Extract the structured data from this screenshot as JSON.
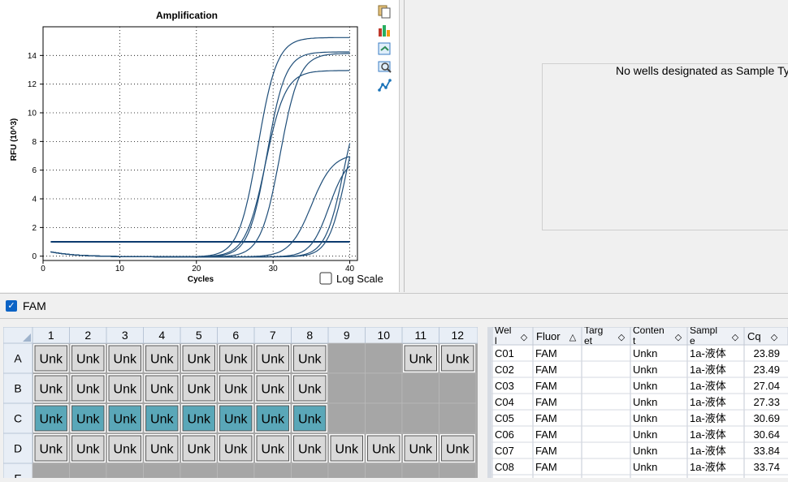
{
  "chart": {
    "title": "Amplification",
    "xlabel": "Cycles",
    "ylabel": "RFU (10^3)",
    "log_scale_label": "Log Scale",
    "x_ticks": [
      "0",
      "10",
      "20",
      "30",
      "40"
    ],
    "y_ticks": [
      "0",
      "2",
      "4",
      "6",
      "8",
      "10",
      "12",
      "14"
    ]
  },
  "chart_data": {
    "type": "line",
    "title": "Amplification",
    "xlabel": "Cycles",
    "ylabel": "RFU (10^3)",
    "xlim": [
      0,
      41
    ],
    "ylim": [
      -0.3,
      16
    ],
    "grid": true,
    "threshold": 1.0,
    "series": [
      {
        "values_at": "sigmoid",
        "baseline": 0.0,
        "max": 15.3,
        "midpoint": 28.0,
        "slope": 1.25
      },
      {
        "values_at": "sigmoid",
        "baseline": 0.0,
        "max": 14.3,
        "midpoint": 29.2,
        "slope": 1.2
      },
      {
        "values_at": "sigmoid",
        "baseline": 0.0,
        "max": 13.0,
        "midpoint": 29.0,
        "slope": 1.3
      },
      {
        "values_at": "sigmoid",
        "baseline": 0.0,
        "max": 14.2,
        "midpoint": 30.9,
        "slope": 1.25
      },
      {
        "values_at": "sigmoid",
        "baseline": 0.0,
        "max": 7.2,
        "midpoint": 35.0,
        "slope": 1.4
      },
      {
        "values_at": "sigmoid",
        "baseline": 0.0,
        "max": 7.0,
        "midpoint": 37.3,
        "slope": 1.2
      },
      {
        "values_at": "sigmoid",
        "baseline": 0.0,
        "max": 12.0,
        "midpoint": 39.2,
        "slope": 1.2
      },
      {
        "values_at": "sigmoid",
        "baseline": 0.0,
        "max": 11.5,
        "midpoint": 39.5,
        "slope": 1.15
      }
    ]
  },
  "right_pane": {
    "message": "No wells designated as Sample Ty"
  },
  "fluor_bar": {
    "label": "FAM",
    "checked": true
  },
  "plate": {
    "columns": [
      "1",
      "2",
      "3",
      "4",
      "5",
      "6",
      "7",
      "8",
      "9",
      "10",
      "11",
      "12"
    ],
    "rows": [
      {
        "label": "A",
        "wells": [
          "Unk",
          "Unk",
          "Unk",
          "Unk",
          "Unk",
          "Unk",
          "Unk",
          "Unk",
          "",
          "",
          "Unk",
          "Unk"
        ],
        "selected": false
      },
      {
        "label": "B",
        "wells": [
          "Unk",
          "Unk",
          "Unk",
          "Unk",
          "Unk",
          "Unk",
          "Unk",
          "Unk",
          "",
          "",
          "",
          ""
        ],
        "selected": false
      },
      {
        "label": "C",
        "wells": [
          "Unk",
          "Unk",
          "Unk",
          "Unk",
          "Unk",
          "Unk",
          "Unk",
          "Unk",
          "",
          "",
          "",
          ""
        ],
        "selected": true
      },
      {
        "label": "D",
        "wells": [
          "Unk",
          "Unk",
          "Unk",
          "Unk",
          "Unk",
          "Unk",
          "Unk",
          "Unk",
          "Unk",
          "Unk",
          "Unk",
          "Unk"
        ],
        "selected": false
      },
      {
        "label": "E",
        "wells": [
          "",
          "",
          "",
          "",
          "",
          "",
          "",
          "",
          "",
          "",
          "",
          ""
        ],
        "selected": false
      }
    ]
  },
  "table": {
    "headers": [
      "Well",
      "Fluor",
      "Target",
      "Content",
      "Sample",
      "Cq"
    ],
    "header_display": [
      "Wel\nl",
      "Fluor",
      "Targ\net",
      "Conten\nt",
      "Sampl\ne",
      "Cq"
    ],
    "sort_icons": [
      "◇",
      "△",
      "◇",
      "◇",
      "◇",
      "◇"
    ],
    "rows": [
      [
        "C01",
        "FAM",
        "",
        "Unkn",
        "1a-液体",
        "23.89"
      ],
      [
        "C02",
        "FAM",
        "",
        "Unkn",
        "1a-液体",
        "23.49"
      ],
      [
        "C03",
        "FAM",
        "",
        "Unkn",
        "1a-液体",
        "27.04"
      ],
      [
        "C04",
        "FAM",
        "",
        "Unkn",
        "1a-液体",
        "27.33"
      ],
      [
        "C05",
        "FAM",
        "",
        "Unkn",
        "1a-液体",
        "30.69"
      ],
      [
        "C06",
        "FAM",
        "",
        "Unkn",
        "1a-液体",
        "30.64"
      ],
      [
        "C07",
        "FAM",
        "",
        "Unkn",
        "1a-液体",
        "33.84"
      ],
      [
        "C08",
        "FAM",
        "",
        "Unkn",
        "1a-液体",
        "33.74"
      ]
    ]
  },
  "toolbar": {
    "icons": [
      "copy-icon",
      "chart-export-icon",
      "refresh-icon",
      "zoom-chart-icon",
      "trend-line-icon"
    ]
  },
  "colors": {
    "curve": "#1f4e79",
    "threshold": "#0b3a6e",
    "selected_well": "#5aa7b8",
    "empty_well": "#a6a6a6",
    "well": "#d9d9d9",
    "checkbox_accent": "#0b63c5"
  }
}
